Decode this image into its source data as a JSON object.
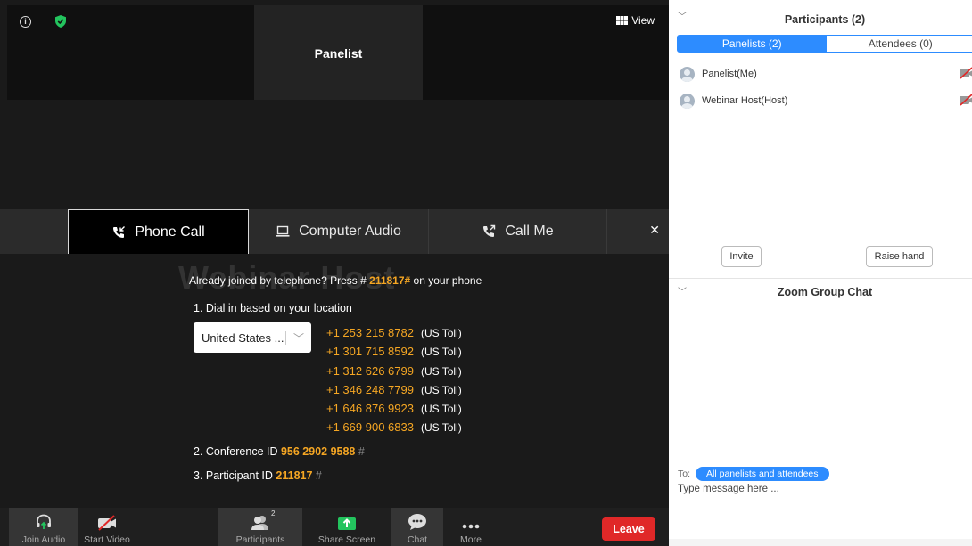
{
  "top": {
    "panelist_label": "Panelist",
    "view_label": "View"
  },
  "audio_tabs": {
    "phone": "Phone Call",
    "computer": "Computer Audio",
    "callme": "Call Me"
  },
  "phone_panel": {
    "ghost_name": "Webinar Host",
    "already_prefix": "Already joined by telephone? Press # ",
    "already_code": "211817#",
    "already_suffix": " on your phone",
    "step1": "1. Dial in based on your location",
    "country": "United States ...",
    "numbers": [
      {
        "number": "+1 253 215 8782",
        "toll": "(US Toll)"
      },
      {
        "number": "+1 301 715 8592",
        "toll": "(US Toll)"
      },
      {
        "number": "+1 312 626 6799",
        "toll": "(US Toll)"
      },
      {
        "number": "+1 346 248 7799",
        "toll": "(US Toll)"
      },
      {
        "number": "+1 646 876 9923",
        "toll": "(US Toll)"
      },
      {
        "number": "+1 669 900 6833",
        "toll": "(US Toll)"
      }
    ],
    "conf_label": "2. Conference ID ",
    "conf_id": "956 2902 9588",
    "part_label": "3. Participant ID ",
    "part_id": "211817",
    "hash": "#"
  },
  "toolbar": {
    "join_audio": "Join Audio",
    "start_video": "Start Video",
    "participants": "Participants",
    "participants_count": "2",
    "share_screen": "Share Screen",
    "chat": "Chat",
    "more": "More",
    "leave": "Leave"
  },
  "participants_panel": {
    "title": "Participants (2)",
    "tab_panelists": "Panelists (2)",
    "tab_attendees": "Attendees (0)",
    "people": [
      {
        "name": "Panelist(Me)"
      },
      {
        "name": "Webinar Host(Host)"
      }
    ],
    "invite": "Invite",
    "raise_hand": "Raise hand"
  },
  "chat_panel": {
    "title": "Zoom Group Chat",
    "to_label": "To:",
    "to_target": "All panelists and attendees",
    "placeholder": "Type message here ..."
  },
  "colors": {
    "accent_blue": "#2d8cff",
    "number_orange": "#f5a623",
    "leave_red": "#e02828",
    "security_green": "#23c45e"
  }
}
